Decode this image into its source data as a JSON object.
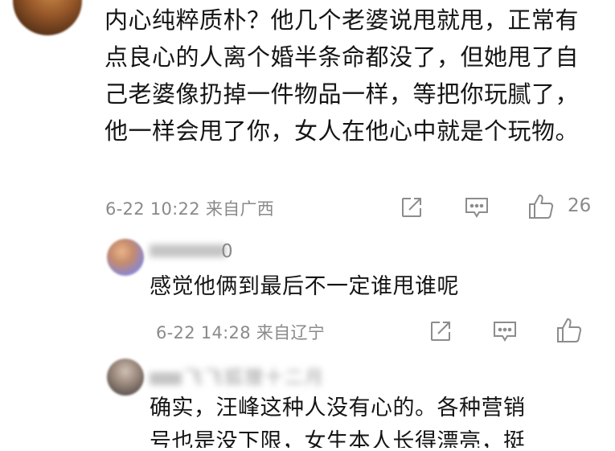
{
  "main_comment": {
    "text": "内心纯粹质朴？他几个老婆说甩就甩，正常有点良心的人离个婚半条命都没了，但她甩了自己老婆像扔掉一件物品一样，等把你玩腻了，他一样会甩了你，女人在他心中就是个玩物。",
    "timestamp": "6-22 10:22",
    "location": "来自广西",
    "like_count": "26",
    "icons": [
      "share-icon",
      "comment-icon",
      "like-icon"
    ]
  },
  "replies": [
    {
      "username_blurred": "",
      "username_suffix": "0",
      "text": "感觉他俩到最后不一定谁甩谁呢",
      "timestamp": "6-22 14:28",
      "location": "来自辽宁",
      "icons": [
        "share-icon",
        "comment-icon",
        "like-icon"
      ]
    },
    {
      "username_blurred": "飞飞狐狸十二月",
      "text_line1": "确实，汪峰这种人没有心的。各种营销",
      "text_line2": "号也是没下限，女生本人长得漂亮，挺"
    }
  ],
  "colors": {
    "text": "#151515",
    "meta": "#8a8a8a",
    "icon": "#8c8c8c",
    "background": "#ffffff"
  }
}
